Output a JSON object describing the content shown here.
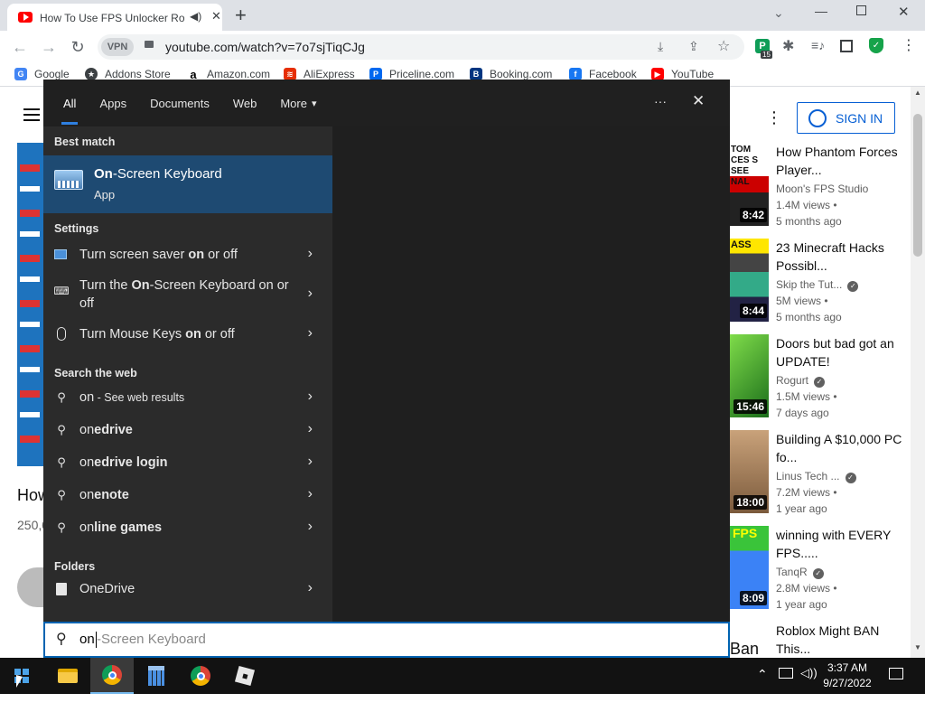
{
  "browser": {
    "tab_title": "How To Use FPS Unlocker Ro",
    "url": "youtube.com/watch?v=7o7sjTiqCJg",
    "vpn_label": "VPN",
    "ext_badge": "15",
    "new_tab": "+",
    "bookmarks": [
      {
        "label": "Google",
        "icon": "google-icon",
        "color": "#4285f4"
      },
      {
        "label": "Addons Store",
        "icon": "addons-icon",
        "color": "#3c4043"
      },
      {
        "label": "Amazon.com",
        "icon": "amazon-icon",
        "color": "#000000"
      },
      {
        "label": "AliExpress",
        "icon": "aliexpress-icon",
        "color": "#e62e04"
      },
      {
        "label": "Priceline.com",
        "icon": "priceline-icon",
        "color": "#0068ef"
      },
      {
        "label": "Booking.com",
        "icon": "booking-icon",
        "color": "#003580"
      },
      {
        "label": "Facebook",
        "icon": "facebook-icon",
        "color": "#1877f2"
      },
      {
        "label": "YouTube",
        "icon": "youtube-icon",
        "color": "#ff0000"
      }
    ]
  },
  "youtube": {
    "sign_in": "SIGN IN",
    "video_title_partial": "How",
    "views_partial": "250,0",
    "videos": [
      {
        "title": "How Phantom Forces Player...",
        "channel": "Moon's FPS Studio",
        "views": "1.4M views",
        "age": "5 months ago",
        "duration": "8:42",
        "verified": false
      },
      {
        "title": "23 Minecraft Hacks Possibl...",
        "channel": "Skip the Tut...",
        "views": "5M views",
        "age": "5 months ago",
        "duration": "8:44",
        "verified": true
      },
      {
        "title": "Doors but bad got an UPDATE!",
        "channel": "Rogurt",
        "views": "1.5M views",
        "age": "7 days ago",
        "duration": "15:46",
        "verified": true
      },
      {
        "title": "Building A $10,000 PC fo...",
        "channel": "Linus Tech ...",
        "views": "7.2M views",
        "age": "1 year ago",
        "duration": "18:00",
        "verified": true
      },
      {
        "title": "winning with EVERY FPS.....",
        "channel": "TanqR",
        "views": "2.8M views",
        "age": "1 year ago",
        "duration": "8:09",
        "verified": true
      },
      {
        "title": "Roblox Might BAN This...",
        "channel": "",
        "views": "",
        "age": "",
        "duration": "",
        "verified": false
      }
    ],
    "thumb_text": [
      "TOM CES S SEE NAL",
      "ASS",
      "",
      "",
      "FPS",
      "Ban"
    ]
  },
  "search": {
    "tabs": [
      "All",
      "Apps",
      "Documents",
      "Web",
      "More"
    ],
    "more_caret": "▾",
    "ellipsis": "···",
    "close": "✕",
    "best_match_header": "Best match",
    "best_match": {
      "name_bold": "On",
      "name_rest": "-Screen Keyboard",
      "type": "App"
    },
    "settings_header": "Settings",
    "settings": [
      {
        "pre": "Turn screen saver ",
        "bold": "on",
        "post": " or off"
      },
      {
        "pre": "Turn the ",
        "bold": "On",
        "post": "-Screen Keyboard on or off"
      },
      {
        "pre": "Turn Mouse Keys ",
        "bold": "on",
        "post": " or off"
      }
    ],
    "web_header": "Search the web",
    "web": [
      {
        "pre": "on",
        "bold": "",
        "post": " - See web results",
        "small": true
      },
      {
        "pre": "on",
        "bold": "edrive",
        "post": "",
        "small": false
      },
      {
        "pre": "on",
        "bold": "edrive login",
        "post": "",
        "small": false
      },
      {
        "pre": "on",
        "bold": "enote",
        "post": "",
        "small": false
      },
      {
        "pre": "on",
        "bold": "line games",
        "post": "",
        "small": false
      }
    ],
    "folders_header": "Folders",
    "folders": [
      {
        "pre": "On",
        "bold": "",
        "post": "eDrive"
      }
    ],
    "query_typed": "on",
    "query_suggest": "-Screen Keyboard"
  },
  "taskbar": {
    "time": "3:37 AM",
    "date": "9/27/2022"
  }
}
